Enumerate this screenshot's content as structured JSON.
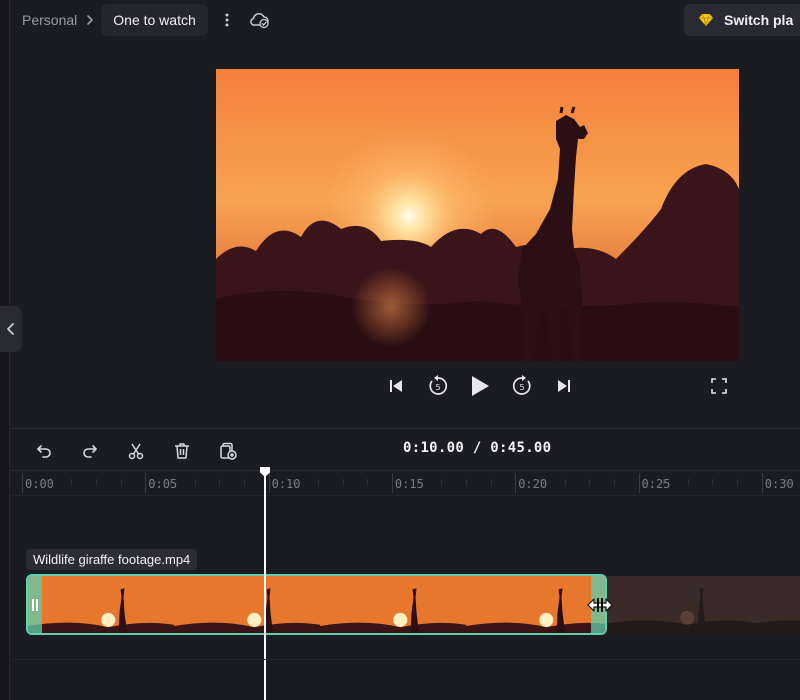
{
  "header": {
    "breadcrumb_root": "Personal",
    "project_name": "One to watch",
    "switch_button_label": "Switch pla"
  },
  "icons": {
    "chevron": "chevron-right-icon",
    "more": "kebab-menu-icon",
    "cloud": "cloud-saved-icon",
    "gem": "diamond-icon"
  },
  "player": {
    "controls": [
      "skip-to-start",
      "rewind-5",
      "play",
      "forward-5",
      "skip-to-end",
      "fullscreen"
    ]
  },
  "timeline": {
    "timecode": "0:10.00 / 0:45.00",
    "ruler_labels": [
      "0:00",
      "0:05",
      "0:10",
      "0:15",
      "0:20",
      "0:25",
      "0:30"
    ],
    "clip_name": "Wildlife giraffe footage.mp4",
    "tools": [
      "undo",
      "redo",
      "split",
      "delete",
      "duplicate"
    ]
  },
  "colors": {
    "background": "#1b1b22",
    "clip_border": "#5fcfae",
    "sunset_orange": "#f08a3c",
    "gem_yellow": "#f5c518"
  }
}
